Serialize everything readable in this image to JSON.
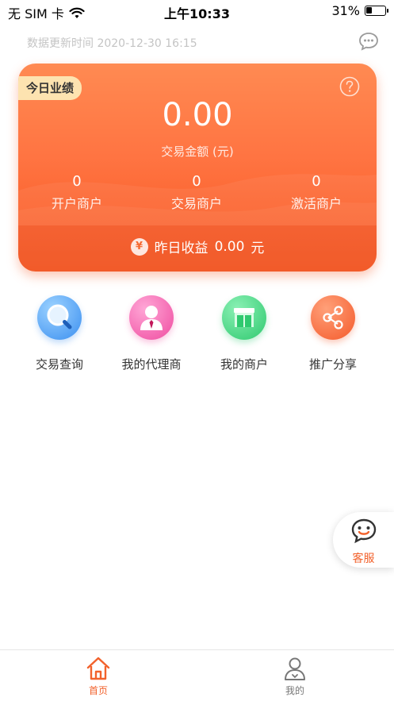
{
  "status_bar": {
    "carrier": "无 SIM 卡",
    "time": "上午10:33",
    "battery_percent": "31%",
    "battery_level": 0.31
  },
  "header": {
    "update_time": "数据更新时间 2020-12-30 16:15",
    "chat_icon": "chat-bubble-icon"
  },
  "card": {
    "badge": "今日业绩",
    "help_icon": "question-circle-icon",
    "amount": "0.00",
    "amount_label": "交易金额 (元)",
    "stats": [
      {
        "value": "0",
        "label": "开户商户"
      },
      {
        "value": "0",
        "label": "交易商户"
      },
      {
        "value": "0",
        "label": "激活商户"
      }
    ],
    "yesterday_prefix": "昨日收益",
    "yesterday_value": "0.00",
    "yesterday_unit": "元",
    "yen_symbol": "¥",
    "colors": {
      "gradient_top": "#ff8a52",
      "gradient_bottom": "#f7561f",
      "badge_bg": "#fde3b0"
    }
  },
  "actions": [
    {
      "label": "交易查询",
      "icon": "search-icon",
      "color": "#3b8ff0"
    },
    {
      "label": "我的代理商",
      "icon": "agent-person-icon",
      "color": "#ef4ca0"
    },
    {
      "label": "我的商户",
      "icon": "shop-icon",
      "color": "#2fc96f"
    },
    {
      "label": "推广分享",
      "icon": "share-icon",
      "color": "#f45a2b"
    }
  ],
  "customer_service": {
    "label": "客服",
    "icon": "smile-chat-icon"
  },
  "tabbar": {
    "home_label": "首页",
    "mine_label": "我的",
    "accent": "#f2622c"
  }
}
